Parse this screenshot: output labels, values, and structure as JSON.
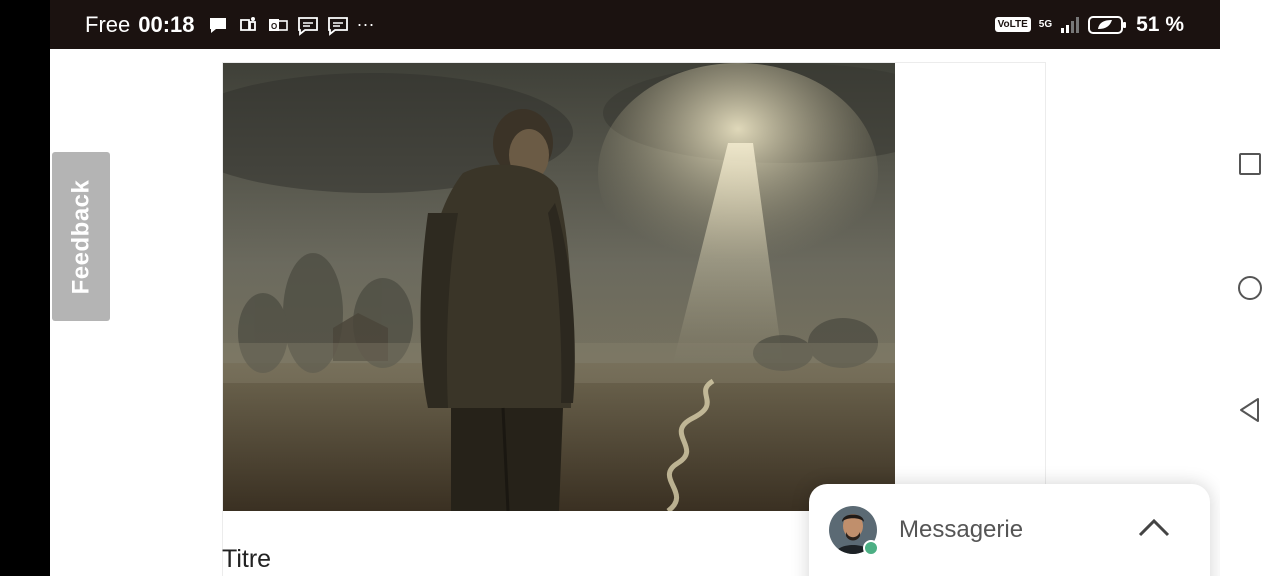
{
  "status_bar": {
    "carrier": "Free",
    "time": "00:18",
    "more": "···",
    "volte": "VoLTE",
    "network": "5G",
    "battery": "51 %",
    "notification_icons": [
      "chat-bubble-icon",
      "teams-icon",
      "outlook-icon",
      "message-icon",
      "message-icon"
    ]
  },
  "feedback": {
    "label": "Feedback"
  },
  "article": {
    "title": "Titre"
  },
  "messaging": {
    "label": "Messagerie",
    "status_color": "#4caf84"
  },
  "colors": {
    "status_bar_bg": "#1b1210",
    "feedback_bg": "#b4b4b4"
  }
}
